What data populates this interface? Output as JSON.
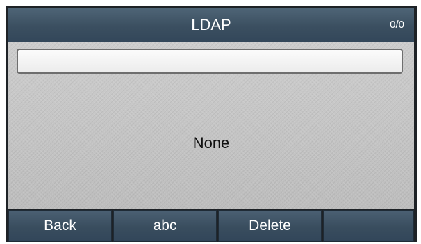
{
  "header": {
    "title": "LDAP",
    "counter": "0/0"
  },
  "search": {
    "value": "",
    "placeholder": ""
  },
  "results": {
    "empty_text": "None"
  },
  "softkeys": [
    {
      "label": "Back"
    },
    {
      "label": "abc"
    },
    {
      "label": "Delete"
    },
    {
      "label": ""
    }
  ],
  "colors": {
    "bar": "#3b4f60",
    "content": "#c9c9c9",
    "frame": "#1e2226"
  }
}
